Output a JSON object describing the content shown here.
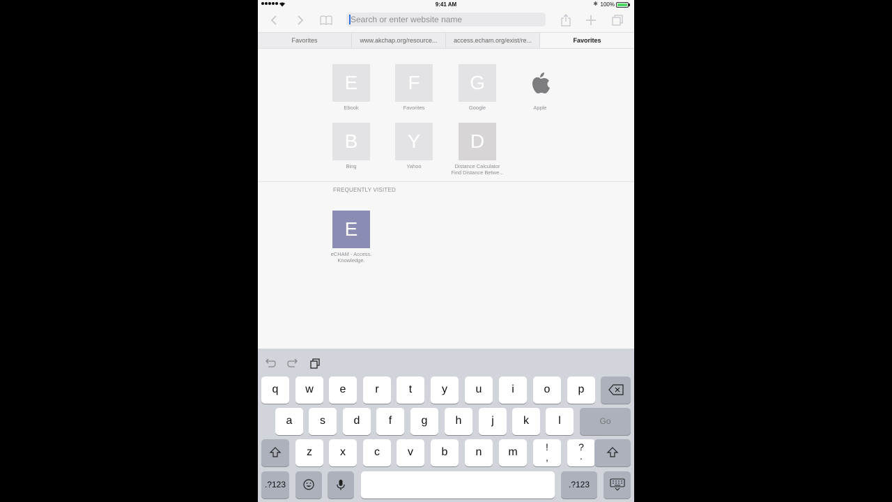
{
  "status_bar": {
    "time": "9:41 AM",
    "battery": "100%"
  },
  "toolbar": {
    "back_icon": "chevron-left-icon",
    "forward_icon": "chevron-right-icon",
    "bookmarks_icon": "book-icon",
    "url_placeholder": "Search or enter website name",
    "share_icon": "share-icon",
    "new_tab_icon": "plus-icon",
    "tabs_icon": "tabs-icon"
  },
  "tabs": [
    {
      "label": "Favorites"
    },
    {
      "label": "www.akchap.org/resource..."
    },
    {
      "label": "access.echam.org/exist/re..."
    },
    {
      "label": "Favorites"
    }
  ],
  "favorites": [
    {
      "letter": "E",
      "label": "Ebook"
    },
    {
      "letter": "F",
      "label": "Favorites"
    },
    {
      "letter": "G",
      "label": "Google"
    },
    {
      "letter": "",
      "label": "Apple"
    },
    {
      "letter": "B",
      "label": "Bing"
    },
    {
      "letter": "Y",
      "label": "Yahoo"
    },
    {
      "letter": "D",
      "label_line1": "Distance Calculator",
      "label_line2": "Find Distance Betwe..."
    }
  ],
  "frequently_visited": {
    "title": "FREQUENTLY VISITED",
    "items": [
      {
        "letter": "E",
        "label_line1": "eCHAM - Access.",
        "label_line2": "Knowledge."
      }
    ]
  },
  "keyboard": {
    "row1": [
      "q",
      "w",
      "e",
      "r",
      "t",
      "y",
      "u",
      "i",
      "o",
      "p"
    ],
    "row2": [
      "a",
      "s",
      "d",
      "f",
      "g",
      "h",
      "j",
      "k",
      "l"
    ],
    "row3": [
      "z",
      "x",
      "c",
      "v",
      "b",
      "n",
      "m"
    ],
    "exclaim_top": "!",
    "exclaim_bottom": ",",
    "question_top": "?",
    "question_bottom": ".",
    "go_label": "Go",
    "numbers_label": ".?123",
    "numbers_label_right": ".?123"
  }
}
